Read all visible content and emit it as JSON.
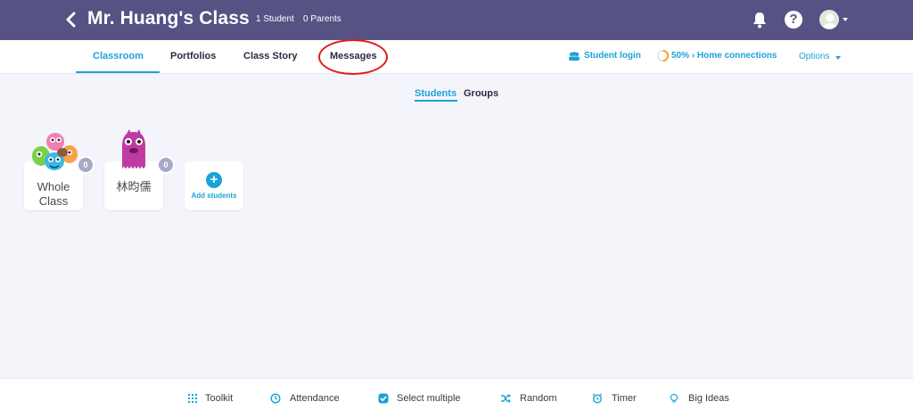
{
  "header": {
    "title": "Mr. Huang's Class",
    "students_count": "1 Student",
    "parents_count": "0 Parents",
    "help_symbol": "?"
  },
  "nav": {
    "tabs": [
      {
        "label": "Classroom",
        "active": true
      },
      {
        "label": "Portfolios"
      },
      {
        "label": "Class Story"
      },
      {
        "label": "Messages",
        "annotated": true
      }
    ],
    "student_login": "Student login",
    "home_connections": "50% › Home connections",
    "options": "Options"
  },
  "subtabs": {
    "students": "Students",
    "groups": "Groups"
  },
  "cards": {
    "whole_class": {
      "label_line1": "Whole",
      "label_line2": "Class",
      "points": "0"
    },
    "student": {
      "name": "林昀儒",
      "points": "0"
    },
    "add": {
      "label": "Add students",
      "symbol": "+"
    }
  },
  "toolbar": {
    "items": [
      {
        "label": "Toolkit",
        "icon": "grid-icon"
      },
      {
        "label": "Attendance",
        "icon": "clock-icon"
      },
      {
        "label": "Select multiple",
        "icon": "check-icon"
      },
      {
        "label": "Random",
        "icon": "shuffle-icon"
      },
      {
        "label": "Timer",
        "icon": "alarm-icon"
      },
      {
        "label": "Big Ideas",
        "icon": "bulb-icon"
      }
    ]
  },
  "colors": {
    "header_bg": "#565284",
    "accent": "#1aa3d8",
    "annotation": "#e01b1b",
    "badge": "#a7a9c6"
  }
}
